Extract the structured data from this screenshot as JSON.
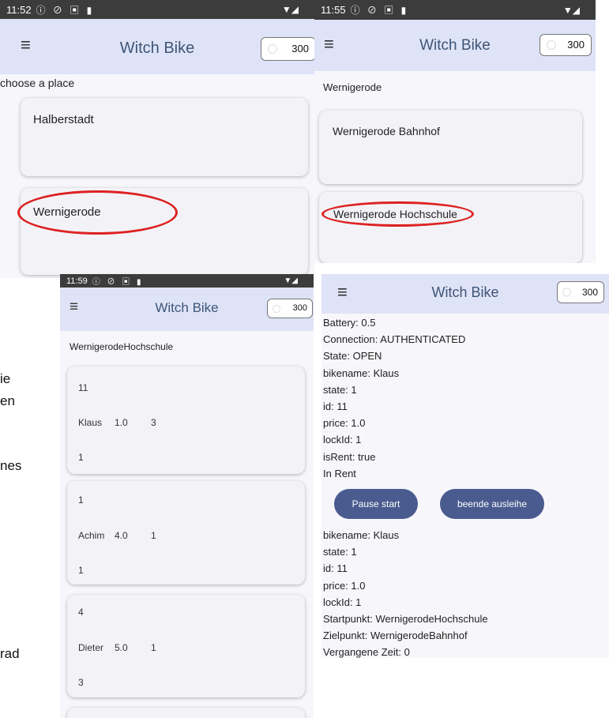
{
  "bg_fragments": [
    "ie",
    "en",
    "nes",
    "rad"
  ],
  "screen1": {
    "status_time": "11:52",
    "app_title": "Witch Bike",
    "credit": "300",
    "caption": "choose a place",
    "cards": [
      "Halberstadt",
      "Wernigerode"
    ]
  },
  "screen2": {
    "status_time": "11:55",
    "app_title": "Witch Bike",
    "credit": "300",
    "caption": "Wernigerode",
    "cards": [
      "Wernigerode Bahnhof",
      "Wernigerode Hochschule"
    ]
  },
  "screen3": {
    "status_time": "11:59",
    "app_title": "Witch Bike",
    "credit": "300",
    "caption": "WernigerodeHochschule",
    "bikes": [
      {
        "id": "11",
        "name": "Klaus",
        "price": "1.0",
        "num": "3",
        "state": "1"
      },
      {
        "id": "1",
        "name": "Achim",
        "price": "4.0",
        "num": "1",
        "state": "1"
      },
      {
        "id": "4",
        "name": "Dieter",
        "price": "5.0",
        "num": "1",
        "state": "3"
      }
    ]
  },
  "screen4": {
    "app_title": "Witch Bike",
    "credit": "300",
    "info_top": [
      "Battery: 0.5",
      "Connection: AUTHENTICATED",
      "State: OPEN",
      "bikename: Klaus",
      "state: 1",
      "id: 11",
      "price: 1.0",
      "lockId: 1",
      "isRent: true",
      "In Rent"
    ],
    "pause_button": "Pause start",
    "end_button": "beende ausleihe",
    "info_bottom": [
      "bikename: Klaus",
      "state: 1",
      "id: 11",
      "price: 1.0",
      "lockId: 1",
      "Startpunkt: WernigerodeHochschule",
      "Zielpunkt: WernigerodeBahnhof",
      "Vergangene Zeit: 0"
    ]
  },
  "colors": {
    "appbar": "#dfe3f7",
    "title": "#3e5577",
    "button": "#4a5b8f",
    "highlight": "#d22222"
  }
}
